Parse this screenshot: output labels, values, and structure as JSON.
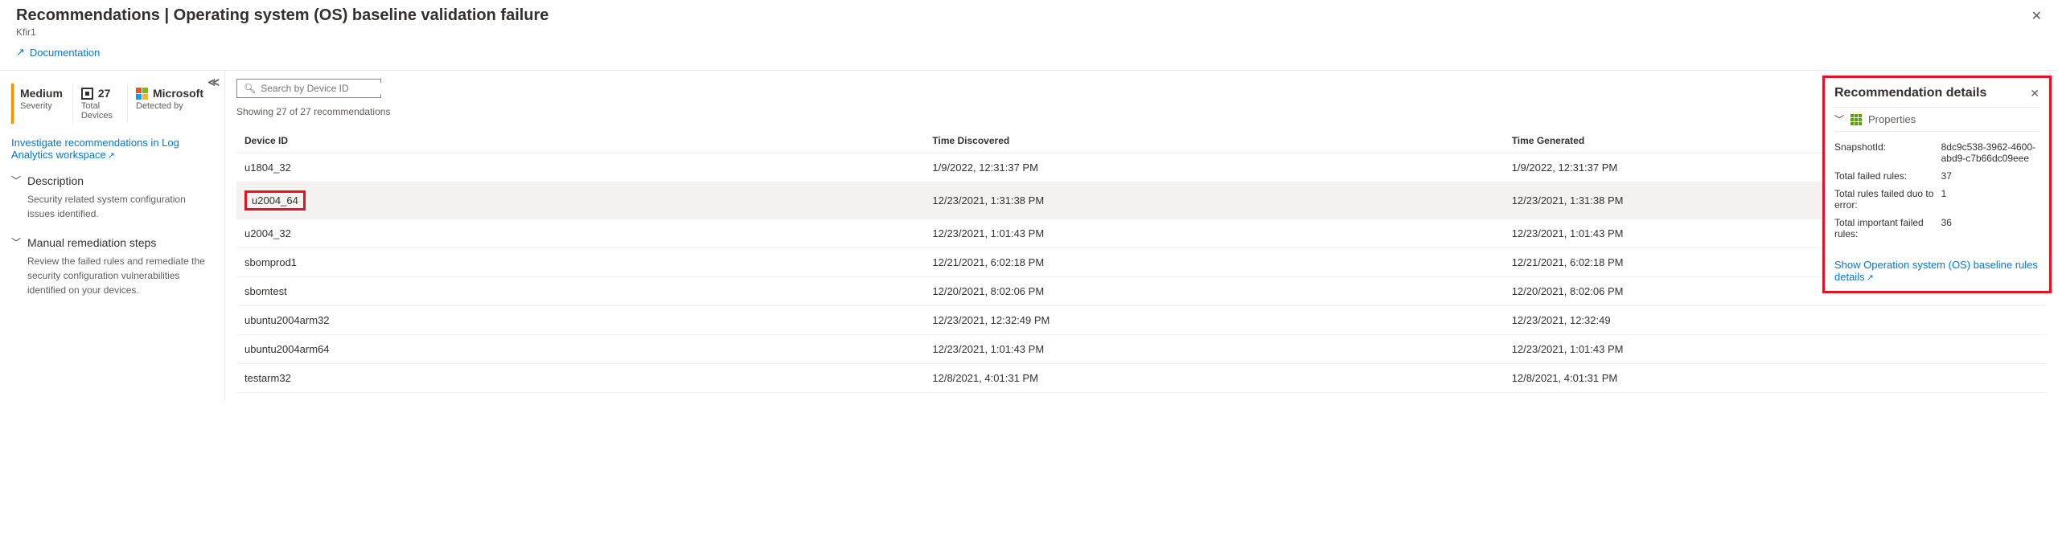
{
  "header": {
    "title": "Recommendations | Operating system (OS) baseline validation failure",
    "subtitle": "Kfir1",
    "ellipsis": "···"
  },
  "doc_link": "Documentation",
  "sidebar": {
    "stats": {
      "severity": {
        "value": "Medium",
        "label": "Severity"
      },
      "devices": {
        "value": "27",
        "label": "Total Devices"
      },
      "detected": {
        "value": "Microsoft",
        "label": "Detected by"
      }
    },
    "investigate_link": "Investigate recommendations in Log Analytics workspace",
    "description": {
      "title": "Description",
      "body": "Security related system configuration issues identified."
    },
    "remediation": {
      "title": "Manual remediation steps",
      "body": "Review the failed rules and remediate the security configuration vulnerabilities identified on your devices."
    }
  },
  "search": {
    "placeholder": "Search by Device ID"
  },
  "showing_text": "Showing 27 of 27 recommendations",
  "columns": {
    "device": "Device ID",
    "discovered": "Time Discovered",
    "generated": "Time Generated"
  },
  "rows": [
    {
      "device": "u1804_32",
      "discovered": "1/9/2022, 12:31:37 PM",
      "generated": "1/9/2022, 12:31:37 PM"
    },
    {
      "device": "u2004_64",
      "discovered": "12/23/2021, 1:31:38 PM",
      "generated": "12/23/2021, 1:31:38 PM"
    },
    {
      "device": "u2004_32",
      "discovered": "12/23/2021, 1:01:43 PM",
      "generated": "12/23/2021, 1:01:43 PM"
    },
    {
      "device": "sbomprod1",
      "discovered": "12/21/2021, 6:02:18 PM",
      "generated": "12/21/2021, 6:02:18 PM"
    },
    {
      "device": "sbomtest",
      "discovered": "12/20/2021, 8:02:06 PM",
      "generated": "12/20/2021, 8:02:06 PM"
    },
    {
      "device": "ubuntu2004arm32",
      "discovered": "12/23/2021, 12:32:49 PM",
      "generated": "12/23/2021, 12:32:49"
    },
    {
      "device": "ubuntu2004arm64",
      "discovered": "12/23/2021, 1:01:43 PM",
      "generated": "12/23/2021, 1:01:43 PM"
    },
    {
      "device": "testarm32",
      "discovered": "12/8/2021, 4:01:31 PM",
      "generated": "12/8/2021, 4:01:31 PM"
    }
  ],
  "details": {
    "title": "Recommendation details",
    "properties_label": "Properties",
    "props": {
      "snapshot_key": "SnapshotId:",
      "snapshot_val": "8dc9c538-3962-4600-abd9-c7b66dc09eee",
      "total_failed_key": "Total failed rules:",
      "total_failed_val": "37",
      "duo_error_key": "Total rules failed duo to error:",
      "duo_error_val": "1",
      "important_key": "Total important failed rules:",
      "important_val": "36"
    },
    "link": "Show Operation system (OS) baseline rules details"
  }
}
